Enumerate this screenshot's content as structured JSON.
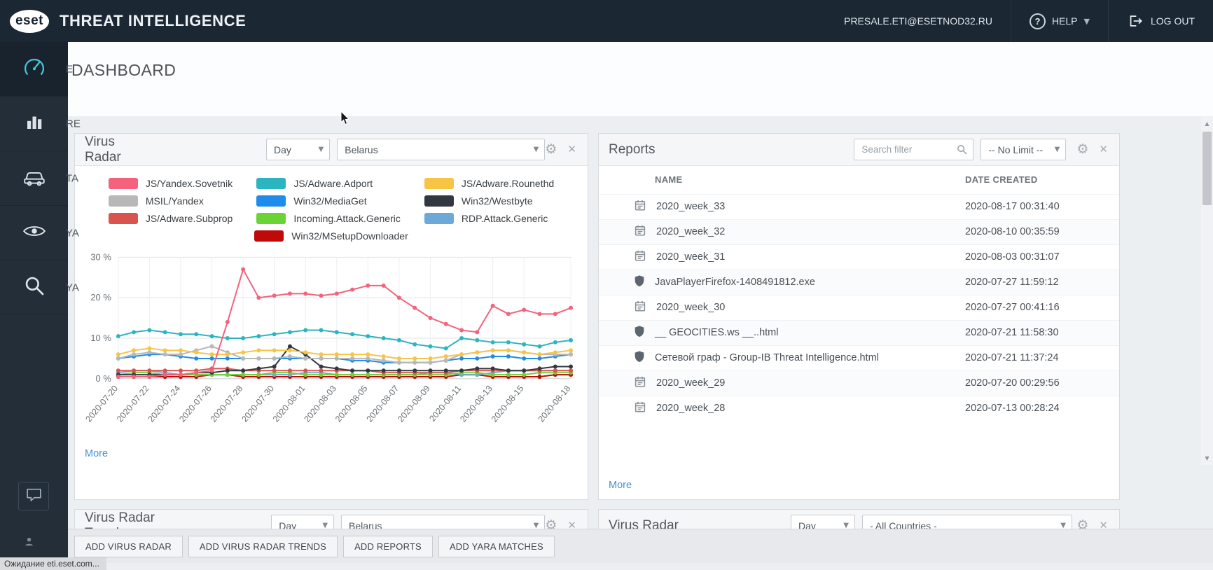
{
  "topbar": {
    "brand": "eset",
    "title": "THREAT INTELLIGENCE",
    "user_email": "PRESALE.ETI@ESETNOD32.RU",
    "help_label": "HELP",
    "logout_label": "LOG OUT"
  },
  "sidebar": {
    "items": [
      {
        "id": "dashboard",
        "icon": "speedometer-icon",
        "fragment": "E",
        "active": true
      },
      {
        "id": "reports",
        "icon": "bar-chart-icon",
        "fragment": "RE",
        "active": false
      },
      {
        "id": "targeted",
        "icon": "car-icon",
        "fragment": "TA",
        "active": false
      },
      {
        "id": "yara-matches",
        "icon": "eye-icon",
        "fragment": "YA",
        "active": false
      },
      {
        "id": "yara-search",
        "icon": "magnifier-icon",
        "fragment": "YA",
        "active": false
      }
    ]
  },
  "page": {
    "title": "DASHBOARD"
  },
  "panels": {
    "virus_radar": {
      "title": "Virus Radar",
      "period_select": "Day",
      "country_select": "Belarus",
      "more_label": "More"
    },
    "reports": {
      "title": "Reports",
      "search_placeholder": "Search filter",
      "limit_select": "-- No Limit --",
      "columns": {
        "name": "NAME",
        "date": "DATE CREATED"
      },
      "rows": [
        {
          "icon": "calendar-icon",
          "name": "2020_week_33",
          "date": "2020-08-17 00:31:40"
        },
        {
          "icon": "calendar-icon",
          "name": "2020_week_32",
          "date": "2020-08-10 00:35:59"
        },
        {
          "icon": "calendar-icon",
          "name": "2020_week_31",
          "date": "2020-08-03 00:31:07"
        },
        {
          "icon": "shield-icon",
          "name": "JavaPlayerFirefox-1408491812.exe",
          "date": "2020-07-27 11:59:12"
        },
        {
          "icon": "calendar-icon",
          "name": "2020_week_30",
          "date": "2020-07-27 00:41:16"
        },
        {
          "icon": "shield-icon",
          "name": "__ GEOCITIES.ws __..html",
          "date": "2020-07-21 11:58:30"
        },
        {
          "icon": "shield-icon",
          "name": "Сетевой граф - Group-IB Threat Intelligence.html",
          "date": "2020-07-21 11:37:24"
        },
        {
          "icon": "calendar-icon",
          "name": "2020_week_29",
          "date": "2020-07-20 00:29:56"
        },
        {
          "icon": "calendar-icon",
          "name": "2020_week_28",
          "date": "2020-07-13 00:28:24"
        }
      ],
      "more_label": "More"
    },
    "virus_radar_trends": {
      "title": "Virus Radar Trends",
      "period_select": "Day",
      "country_select": "Belarus"
    },
    "virus_radar_all": {
      "title": "Virus Radar",
      "period_select": "Day",
      "country_select": "- All Countries -"
    }
  },
  "toolbar": {
    "buttons": [
      "ADD VIRUS RADAR",
      "ADD VIRUS RADAR TRENDS",
      "ADD REPORTS",
      "ADD YARA MATCHES"
    ]
  },
  "status_bar": {
    "text": "Ожидание eti.eset.com..."
  },
  "chart_data": {
    "type": "line",
    "title": "Virus Radar",
    "ylabel": "%",
    "ylim": [
      0,
      30
    ],
    "y_ticks": [
      "0 %",
      "10 %",
      "20 %",
      "30 %"
    ],
    "grid": true,
    "legend_position": "top",
    "x": [
      "2020-07-20",
      "2020-07-21",
      "2020-07-22",
      "2020-07-23",
      "2020-07-24",
      "2020-07-25",
      "2020-07-26",
      "2020-07-27",
      "2020-07-28",
      "2020-07-29",
      "2020-07-30",
      "2020-07-31",
      "2020-08-01",
      "2020-08-02",
      "2020-08-03",
      "2020-08-04",
      "2020-08-05",
      "2020-08-06",
      "2020-08-07",
      "2020-08-08",
      "2020-08-09",
      "2020-08-10",
      "2020-08-11",
      "2020-08-12",
      "2020-08-13",
      "2020-08-14",
      "2020-08-15",
      "2020-08-16",
      "2020-08-17",
      "2020-08-18"
    ],
    "x_tick_labels": [
      "2020-07-20",
      "2020-07-22",
      "2020-07-24",
      "2020-07-26",
      "2020-07-28",
      "2020-07-30",
      "2020-08-01",
      "2020-08-03",
      "2020-08-05",
      "2020-08-07",
      "2020-08-09",
      "2020-08-11",
      "2020-08-13",
      "2020-08-15",
      "2020-08-18"
    ],
    "series": [
      {
        "name": "JS/Yandex.Sovetnik",
        "color": "#f4627d",
        "values": [
          0.5,
          0.5,
          0.5,
          1,
          1,
          1.5,
          2,
          14,
          27,
          20,
          20.5,
          21,
          21,
          20.5,
          21,
          22,
          23,
          23,
          20,
          17.5,
          15,
          13.5,
          12,
          11.5,
          18,
          16,
          17,
          16,
          16,
          17.5
        ]
      },
      {
        "name": "JS/Adware.Adport",
        "color": "#2cb5c0",
        "values": [
          10.5,
          11.5,
          12,
          11.5,
          11,
          11,
          10.5,
          10,
          10,
          10.5,
          11,
          11.5,
          12,
          12,
          11.5,
          11,
          10.5,
          10,
          9.5,
          8.5,
          8,
          7.5,
          10,
          9.5,
          9,
          9,
          8.5,
          8,
          9,
          9.5
        ]
      },
      {
        "name": "JS/Adware.Rounethd",
        "color": "#f8c445",
        "values": [
          6,
          7,
          7.5,
          7,
          7,
          6.5,
          6,
          6,
          6.5,
          7,
          7,
          7,
          6.5,
          6,
          6,
          6,
          6,
          5.5,
          5,
          5,
          5,
          5.5,
          6,
          6.5,
          7,
          7,
          6.5,
          6,
          6.5,
          7
        ]
      },
      {
        "name": "MSIL/Yandex",
        "color": "#b8b8b8",
        "values": [
          5,
          6,
          6.5,
          6,
          6,
          7,
          8,
          6.5,
          5,
          5,
          5,
          5.5,
          5,
          5,
          5,
          5,
          5,
          4.5,
          4,
          4,
          4,
          4.5,
          6,
          6.5,
          7,
          7,
          6.5,
          6,
          6,
          6
        ]
      },
      {
        "name": "Win32/MediaGet",
        "color": "#1f8ceb",
        "values": [
          5,
          5.5,
          6,
          6,
          5.5,
          5,
          5,
          5,
          5,
          5,
          5,
          5,
          5,
          5,
          5,
          4.5,
          4.5,
          4,
          4,
          4,
          4,
          4.5,
          5,
          5,
          5.5,
          5.5,
          5,
          5,
          5.5,
          6
        ]
      },
      {
        "name": "Win32/Westbyte",
        "color": "#32383f",
        "values": [
          1,
          1,
          1,
          1,
          1,
          1.5,
          1.5,
          2,
          2,
          2.5,
          3,
          8,
          6,
          3,
          2.5,
          2,
          2,
          2,
          2,
          2,
          2,
          2,
          2,
          2.5,
          2.5,
          2,
          2,
          2.5,
          3,
          3
        ]
      },
      {
        "name": "JS/Adware.Subprop",
        "color": "#d9534f",
        "values": [
          2,
          2,
          2,
          2,
          2,
          2,
          2.5,
          2.5,
          2,
          2,
          2,
          2,
          2,
          2,
          2,
          2,
          2,
          1.5,
          1.5,
          1.5,
          1.5,
          1.5,
          2,
          2,
          2,
          2,
          2,
          2,
          2,
          2
        ]
      },
      {
        "name": "Incoming.Attack.Generic",
        "color": "#6ad436",
        "values": [
          1,
          1.5,
          1.5,
          1,
          1,
          1,
          1,
          1,
          1,
          1,
          1.5,
          1.5,
          1,
          1,
          1,
          1,
          1,
          1,
          1,
          1,
          1,
          1,
          1.5,
          1.5,
          1,
          1,
          1,
          1.5,
          1.5,
          1.5
        ]
      },
      {
        "name": "RDP.Attack.Generic",
        "color": "#6da9d8",
        "values": [
          1.5,
          2,
          2,
          1.5,
          1,
          1,
          1,
          1,
          1,
          1,
          1,
          1,
          1.5,
          1.5,
          1,
          1,
          1,
          1,
          1,
          1,
          1.5,
          1.5,
          1,
          1,
          1.5,
          2,
          2,
          2,
          2,
          2
        ]
      },
      {
        "name": "Win32/MSetupDownloader",
        "color": "#c00909",
        "values": [
          0.5,
          0.5,
          0.5,
          0.5,
          0.5,
          0.5,
          1,
          1,
          0.5,
          0.5,
          0.5,
          0.5,
          0.5,
          0.5,
          0.5,
          0.5,
          0.5,
          0.5,
          0.5,
          0.5,
          0.5,
          0.5,
          1,
          1,
          0.5,
          0.5,
          0.5,
          0.5,
          1,
          1
        ]
      }
    ]
  }
}
